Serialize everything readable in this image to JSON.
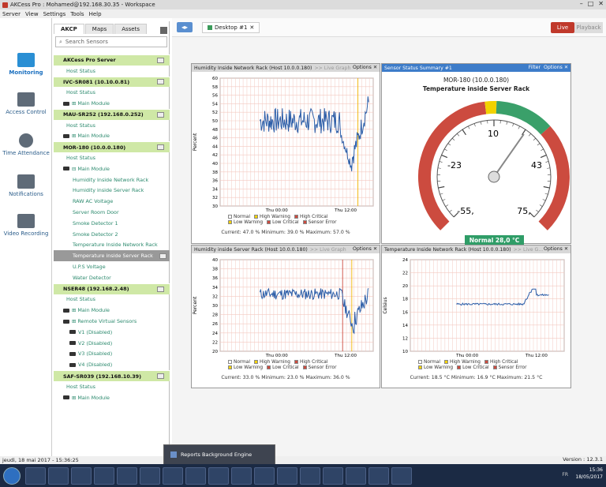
{
  "window": {
    "title": "AKCess Pro : Mohamed@192.168.30.35 - Workspace",
    "controls": [
      "–",
      "□",
      "✕"
    ]
  },
  "menu": [
    "Server",
    "View",
    "Settings",
    "Tools",
    "Help"
  ],
  "nav": [
    {
      "label": "Monitoring",
      "icon": "monitor-icon",
      "active": true
    },
    {
      "label": "Access Control",
      "icon": "access-control-icon",
      "active": false
    },
    {
      "label": "Time Attendance",
      "icon": "clock-icon",
      "active": false
    },
    {
      "label": "Notifications",
      "icon": "notifications-icon",
      "active": false
    },
    {
      "label": "Video Recording",
      "icon": "video-recording-icon",
      "active": false
    }
  ],
  "tree": {
    "tabs": [
      "AKCP",
      "Maps",
      "Assets"
    ],
    "search_placeholder": "Search Sensors",
    "rows": [
      {
        "t": "AKCess Pro Server",
        "type": "group"
      },
      {
        "t": "Host Status",
        "type": "item",
        "indent": 16
      },
      {
        "t": "IVC-SR081 (10.10.0.81)",
        "type": "group"
      },
      {
        "t": "Host Status",
        "type": "item",
        "indent": 16
      },
      {
        "t": "⊞  Main Module",
        "type": "module",
        "indent": 8
      },
      {
        "t": "MAU-SR252 (192.168.0.252)",
        "type": "group"
      },
      {
        "t": "Host Status",
        "type": "item",
        "indent": 16
      },
      {
        "t": "⊞  Main Module",
        "type": "module",
        "indent": 8
      },
      {
        "t": "MOR-180 (10.0.0.180)",
        "type": "group"
      },
      {
        "t": "Host Status",
        "type": "item",
        "indent": 16
      },
      {
        "t": "⊟  Main Module",
        "type": "module",
        "indent": 8
      },
      {
        "t": "Humidity Inside Network Rack",
        "type": "item",
        "indent": 24
      },
      {
        "t": "Humidity inside Server Rack",
        "type": "item",
        "indent": 24
      },
      {
        "t": "RAW AC Voltage",
        "type": "item",
        "indent": 24
      },
      {
        "t": "Server Room Door",
        "type": "item",
        "indent": 24
      },
      {
        "t": "Smoke Detector 1",
        "type": "item",
        "indent": 24
      },
      {
        "t": "Smoke Detector 2",
        "type": "item",
        "indent": 24
      },
      {
        "t": "Temperature Inside Network Rack",
        "type": "item",
        "indent": 24
      },
      {
        "t": "Temperature inside Server Rack",
        "type": "sel",
        "indent": 24
      },
      {
        "t": "U.P.S Voltage",
        "type": "item",
        "indent": 24
      },
      {
        "t": "Water Detector",
        "type": "item",
        "indent": 24
      },
      {
        "t": "NSER48 (192.168.2.48)",
        "type": "group"
      },
      {
        "t": "Host Status",
        "type": "item",
        "indent": 16
      },
      {
        "t": "⊞  Main Module",
        "type": "module",
        "indent": 8
      },
      {
        "t": "⊞  Remote Virtual Sensors",
        "type": "module",
        "indent": 8
      },
      {
        "t": "V1 (Disabled)",
        "type": "dis",
        "indent": 20
      },
      {
        "t": "V2 (Disabled)",
        "type": "dis",
        "indent": 20
      },
      {
        "t": "V3 (Disabled)",
        "type": "dis",
        "indent": 20
      },
      {
        "t": "V4 (Disabled)",
        "type": "dis",
        "indent": 20
      },
      {
        "t": "SAF-SR039 (192.168.10.39)",
        "type": "group"
      },
      {
        "t": "Host Status",
        "type": "item",
        "indent": 16
      },
      {
        "t": "⊞  Main Module",
        "type": "module",
        "indent": 8
      }
    ]
  },
  "workspace": {
    "tab": "Desktop #1",
    "live": "Live",
    "playback": "Playback",
    "arrows": "◂▸"
  },
  "panels": {
    "hum_net": {
      "title": "Humidity Inside Network Rack (Host 10.0.0.180)",
      "live": ">> Live Graph",
      "options": "Options",
      "close": "✕",
      "ylabel": "Percent",
      "x_ticks": [
        "Thu 00:00",
        "Thu 12:00"
      ],
      "y_ticks": [
        "60",
        "58",
        "56",
        "54",
        "52",
        "50",
        "48",
        "46",
        "44",
        "42",
        "40",
        "38",
        "36",
        "34",
        "32",
        "30"
      ],
      "stats": "Current: 47.0 %     Minimum: 39.0 %     Maximum: 57.0 %"
    },
    "gauge": {
      "title": "Sensor Status Summary #1",
      "filter": "Filter",
      "options": "Options",
      "close": "✕",
      "device": "MOR-180 (10.0.0.180)",
      "sensor": "Temperature inside Server Rack",
      "labels": [
        "10",
        "-23",
        "43",
        "-55,",
        "75,"
      ],
      "status": "Normal  28,0 °C"
    },
    "hum_srv": {
      "title": "Humidity inside Server Rack (Host 10.0.0.180)",
      "live": ">> Live Graph",
      "options": "Options",
      "close": "✕",
      "ylabel": "Percent",
      "x_ticks": [
        "Thu 00:00",
        "Thu 12:00"
      ],
      "y_ticks": [
        "40",
        "38",
        "36",
        "34",
        "32",
        "30",
        "28",
        "26",
        "24",
        "22",
        "20"
      ],
      "stats": "Current: 33.0 %     Minimum: 23.0 %     Maximum: 36.0 %"
    },
    "temp_net": {
      "title": "Temperature Inside Network Rack (Host 10.0.0.180)",
      "live": ">> Live G...",
      "options": "Options",
      "close": "✕",
      "ylabel": "Celsius",
      "x_ticks": [
        "Thu 00:00",
        "Thu 12:00"
      ],
      "y_ticks": [
        "24",
        "22",
        "20",
        "18",
        "16",
        "14",
        "12",
        "10"
      ],
      "stats": "Current: 18.5 °C     Minimum: 16.9 °C     Maximum: 21.5 °C"
    }
  },
  "legend": {
    "row1": [
      "Normal",
      "High Warning",
      "High Critical"
    ],
    "row2": [
      "Low Warning",
      "Low Critical",
      "Sensor Error"
    ]
  },
  "statusbar": {
    "datetime": "jeudi, 18 mai 2017 - 15:36:25",
    "version": "Version : 12.3.1"
  },
  "reports": "Reports Background Engine",
  "tray": {
    "time": "15:36",
    "date": "18/05/2017",
    "lang": "FR"
  },
  "colors": {
    "group": "#cfe8a6",
    "live": "#c0392b",
    "gauge_red": "#cc4b3f",
    "gauge_yellow": "#f2d200",
    "gauge_green": "#3aa06a",
    "status_green": "#2f9d67",
    "line": "#2d5ea8"
  }
}
